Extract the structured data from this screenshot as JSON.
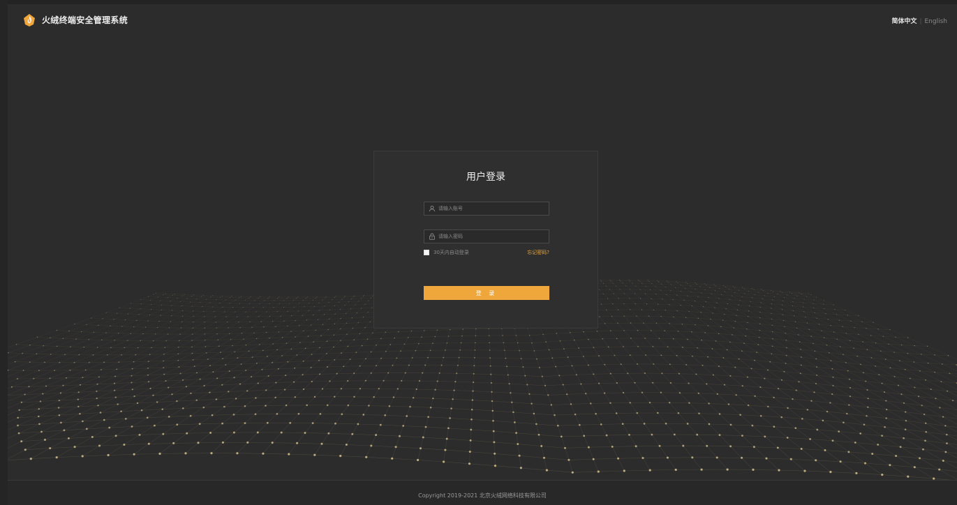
{
  "header": {
    "app_title": "火绒终端安全管理系统",
    "lang_active": "简体中文",
    "lang_separator": "|",
    "lang_other": "English"
  },
  "login": {
    "title": "用户登录",
    "username_placeholder": "请输入账号",
    "password_placeholder": "请输入密码",
    "remember_label": "30天内自动登录",
    "forgot_label": "忘记密码?",
    "submit_label": "登 录"
  },
  "footer": {
    "copyright": "Copyright 2019-2021 北京火绒网络科技有限公司"
  },
  "colors": {
    "accent": "#efa73c",
    "background": "#2c2c2c",
    "card": "#2f2f2f",
    "dots": "#cbb98a"
  },
  "icons": {
    "logo": "shield-logo-icon",
    "username": "user-icon",
    "password": "lock-icon"
  }
}
